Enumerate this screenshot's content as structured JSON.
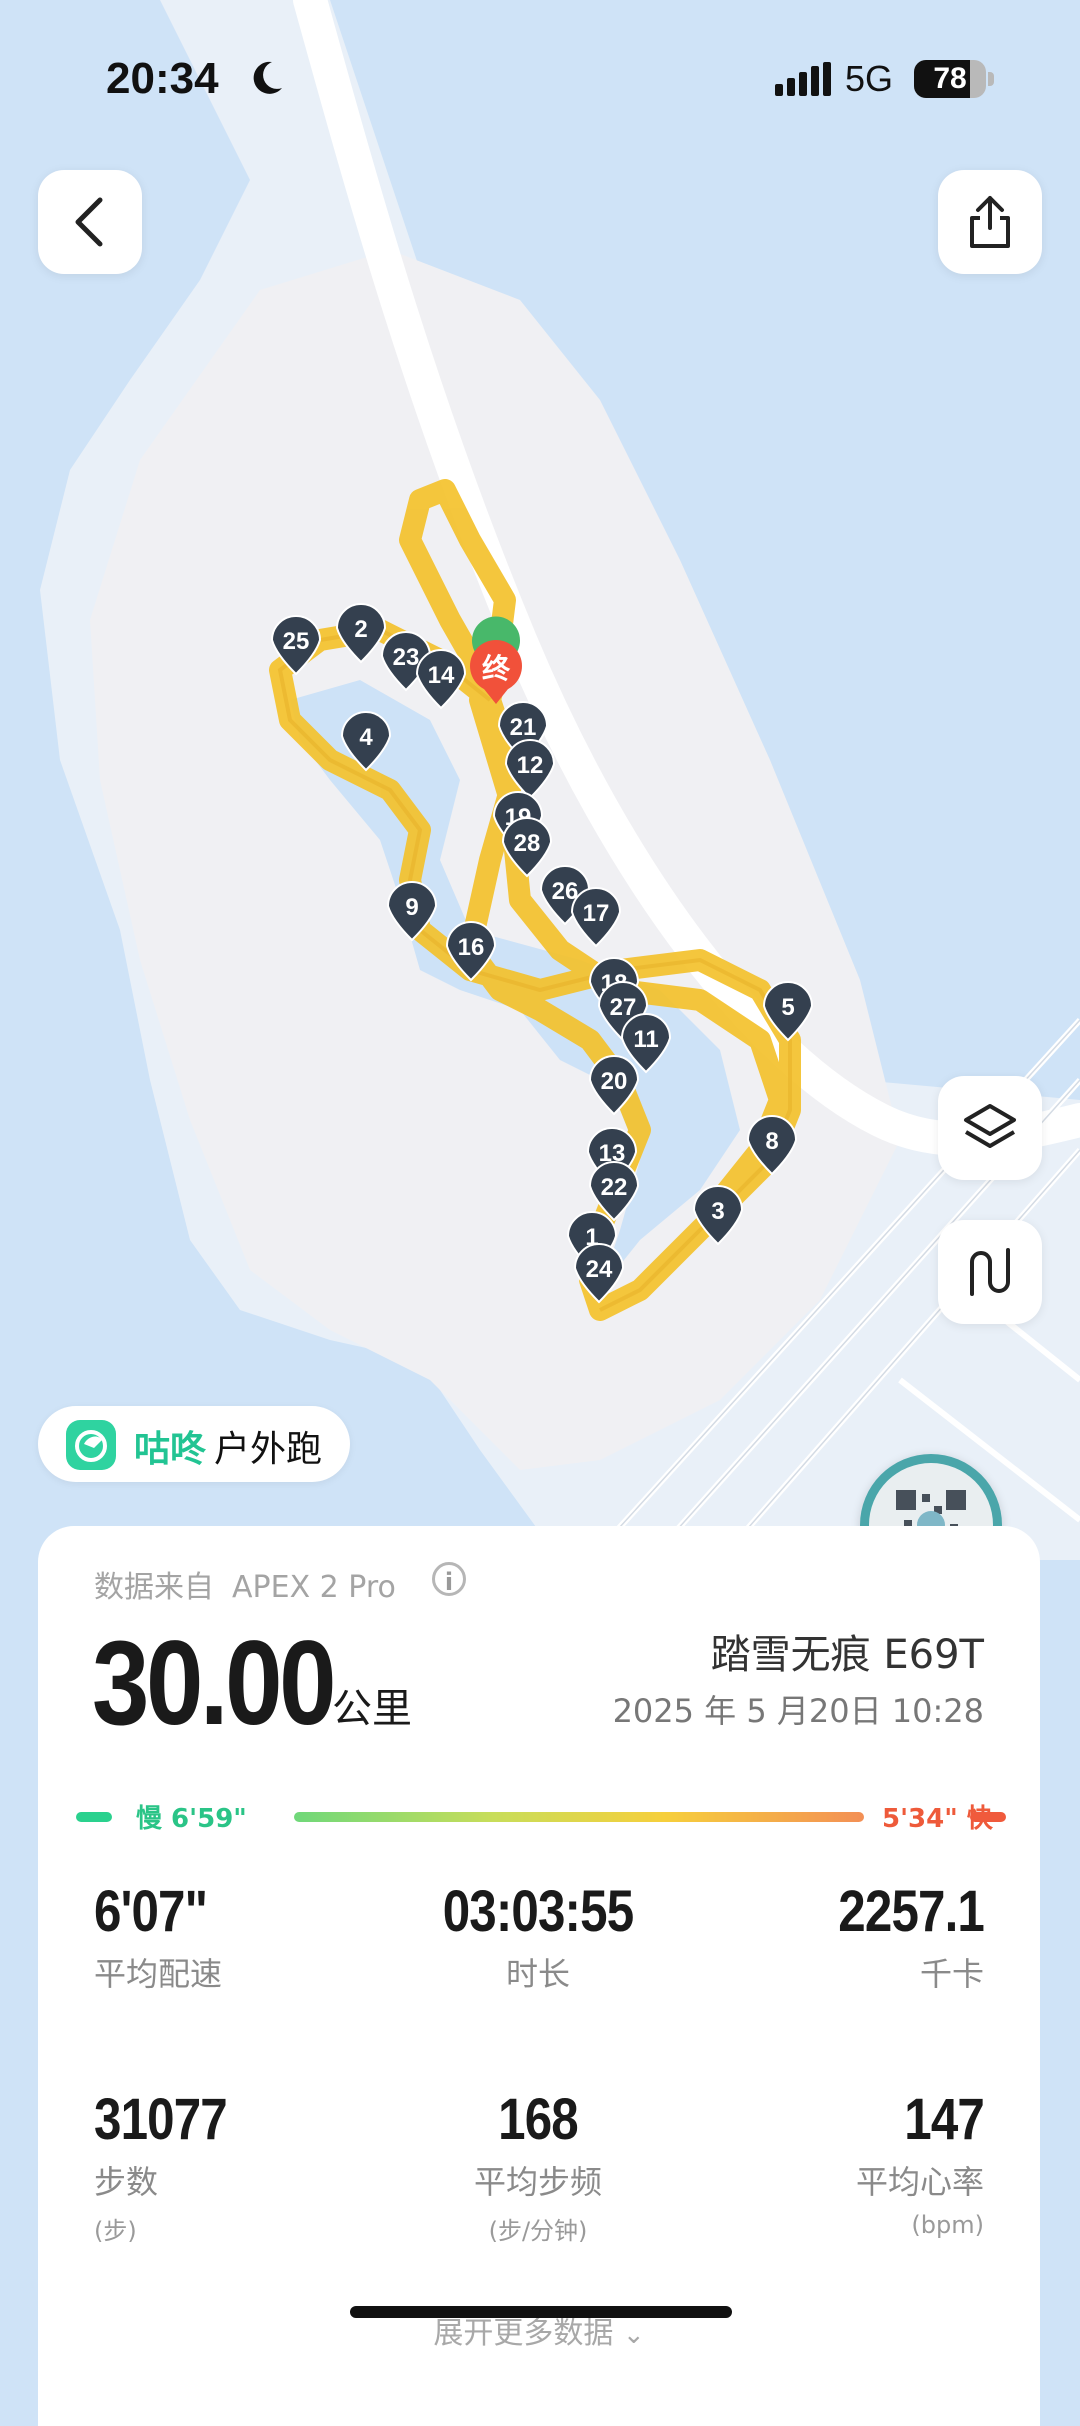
{
  "status_bar": {
    "time": "20:34",
    "network": "5G",
    "battery": "78",
    "battery_level": 0.78
  },
  "map": {
    "end_marker": "终",
    "markers": [
      "25",
      "2",
      "23",
      "14",
      "4",
      "21",
      "12",
      "19",
      "28",
      "9",
      "16",
      "26",
      "17",
      "18",
      "27",
      "11",
      "5",
      "20",
      "8",
      "13",
      "22",
      "3",
      "1",
      "24"
    ]
  },
  "icons": {
    "back": "chevron-left-icon",
    "share": "share-icon",
    "layers": "layers-icon",
    "route": "route-icon",
    "info": "info-icon"
  },
  "brand": {
    "name": "咕咚",
    "type": "户外跑"
  },
  "summary": {
    "source_label": "数据来自",
    "device": "APEX 2 Pro",
    "info_glyph": "i",
    "distance": "30.00",
    "distance_unit": "公里",
    "shoe": "踏雪无痕 E69T",
    "datetime": "2025 年 5 月20日 10:28",
    "pace_slow": "慢 6'59\"",
    "pace_fast": "5'34\" 快"
  },
  "stats": [
    {
      "value": "6'07\"",
      "label": "平均配速",
      "sub": ""
    },
    {
      "value": "03:03:55",
      "label": "时长",
      "sub": ""
    },
    {
      "value": "2257.1",
      "label": "千卡",
      "sub": ""
    },
    {
      "value": "31077",
      "label": "步数",
      "sub": "(步)"
    },
    {
      "value": "168",
      "label": "平均步频",
      "sub": "(步/分钟)"
    },
    {
      "value": "147",
      "label": "平均心率",
      "sub": "(bpm)"
    }
  ],
  "more_label": "展开更多数据",
  "colors": {
    "accent": "#22c493",
    "route": "#f4c22d",
    "slow": "#2ad18e",
    "fast": "#f05a3c",
    "marker": "#34404f"
  }
}
